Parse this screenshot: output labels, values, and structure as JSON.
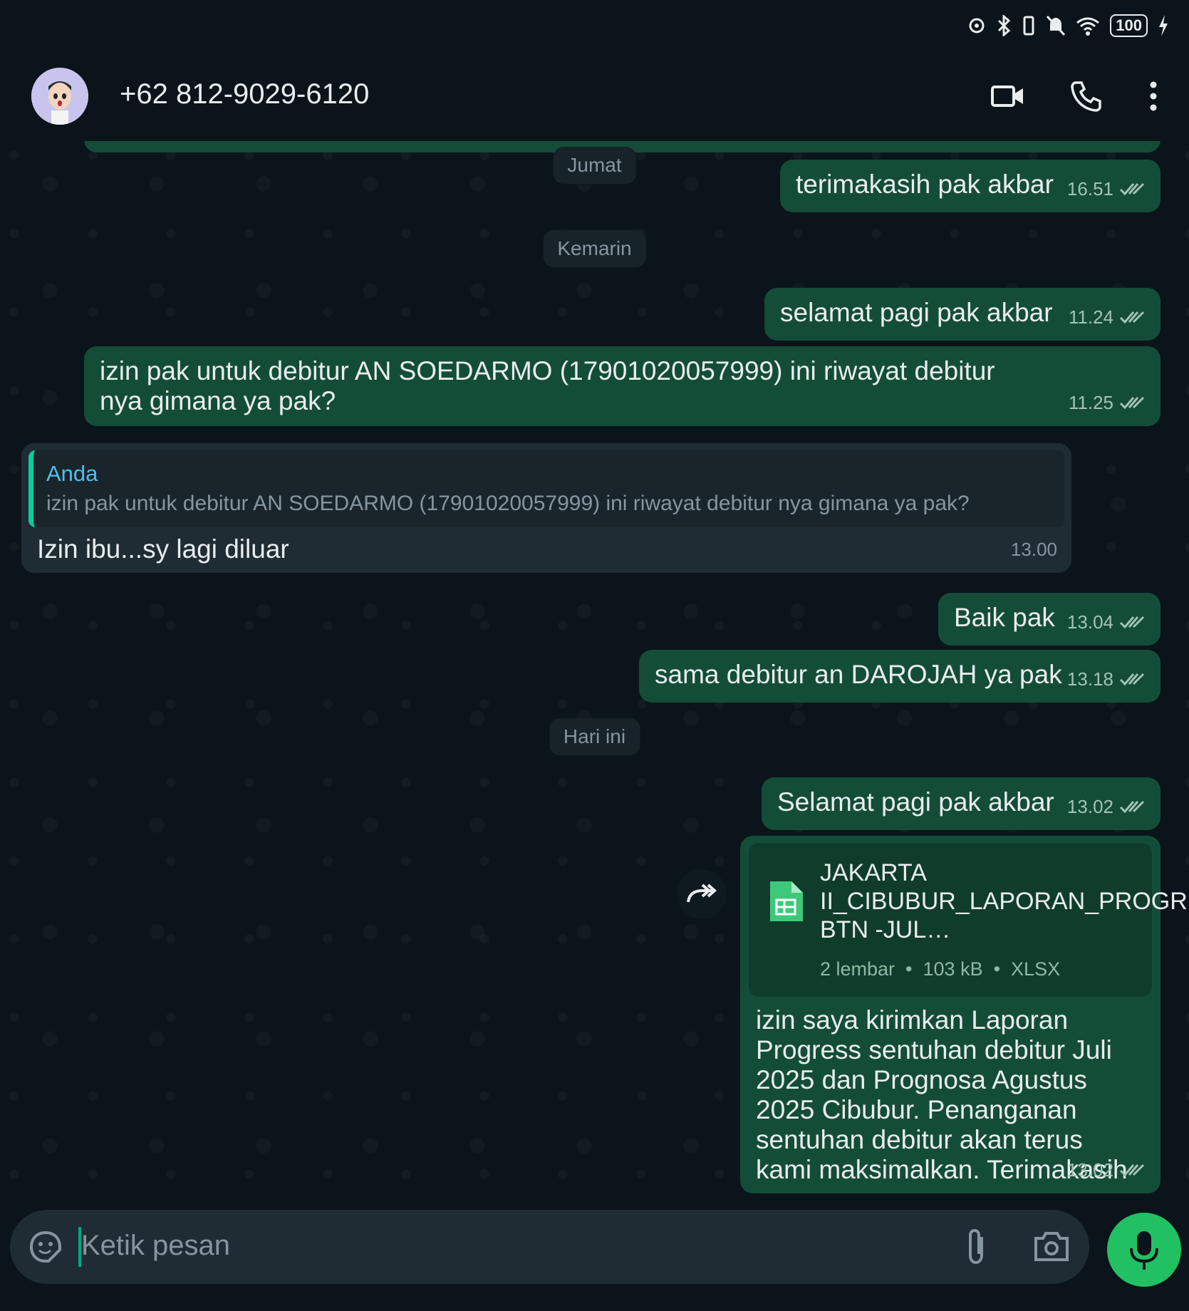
{
  "status": {
    "battery": "100"
  },
  "header": {
    "contact": "+62 812-9029-6120"
  },
  "chat": {
    "day_labels": [
      "Jumat",
      "Kemarin",
      "Hari ini"
    ],
    "messages": [
      {
        "text": "terimakasih pak akbar",
        "time": "16.51"
      },
      {
        "text": "selamat pagi pak akbar",
        "time": "11.24"
      },
      {
        "text": "izin pak untuk debitur AN SOEDARMO (17901020057999) ini riwayat debitur nya gimana ya pak?",
        "time": "11.25"
      },
      {
        "quote_author": "Anda",
        "quote_text": "izin pak untuk debitur AN SOEDARMO (17901020057999) ini riwayat debitur nya gimana ya pak?",
        "text": "Izin ibu...sy lagi diluar",
        "time": "13.00"
      },
      {
        "text": "Baik pak",
        "time": "13.04"
      },
      {
        "text": "sama debitur an DAROJAH ya pak",
        "time": "13.18"
      },
      {
        "text": "Selamat pagi pak akbar",
        "time": "13.02"
      },
      {
        "file_name": "JAKARTA II_CIBUBUR_LAPORAN_PROGRESS BTN -JUL…",
        "file_pages": "2 lembar",
        "file_size": "103 kB",
        "file_type": "XLSX",
        "text": "izin saya kirimkan Laporan Progress sentuhan debitur Juli 2025 dan Prognosa Agustus 2025 Cibubur. Penanganan sentuhan debitur akan terus kami maksimalkan. Terimakasih",
        "time": "13.02"
      }
    ]
  },
  "composer": {
    "placeholder": "Ketik pesan"
  },
  "colors": {
    "background": "#0b141a",
    "outgoing_bubble": "#144d37",
    "incoming_bubble": "#202c33",
    "accent": "#21c063",
    "read_ticks": "#a2c3b5"
  }
}
